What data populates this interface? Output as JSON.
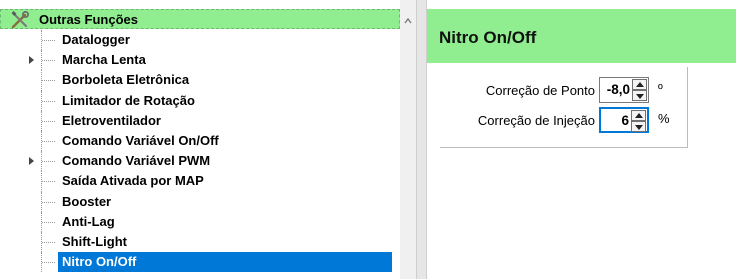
{
  "tree": {
    "header_label": "Outras Funções",
    "items": [
      {
        "label": "Datalogger",
        "expandable": false
      },
      {
        "label": "Marcha Lenta",
        "expandable": true
      },
      {
        "label": "Borboleta Eletrônica",
        "expandable": false
      },
      {
        "label": "Limitador de Rotação",
        "expandable": false
      },
      {
        "label": "Eletroventilador",
        "expandable": false
      },
      {
        "label": "Comando Variável On/Off",
        "expandable": false
      },
      {
        "label": "Comando Variável PWM",
        "expandable": true
      },
      {
        "label": "Saída Ativada por MAP",
        "expandable": false
      },
      {
        "label": "Booster",
        "expandable": false
      },
      {
        "label": "Anti-Lag",
        "expandable": false
      },
      {
        "label": "Shift-Light",
        "expandable": false
      },
      {
        "label": "Nitro On/Off",
        "expandable": false,
        "selected": true
      }
    ]
  },
  "detail": {
    "title": "Nitro On/Off",
    "fields": [
      {
        "label": "Correção de Ponto",
        "value": "-8,0",
        "unit": "º"
      },
      {
        "label": "Correção de Injeção",
        "value": "6",
        "unit": "%"
      }
    ]
  },
  "colors": {
    "header_green": "#90ee90",
    "selection_blue": "#0078d7",
    "focus_blue": "#0078d7"
  },
  "icons": {
    "tree_header": "tools-icon",
    "expander": "expand-arrow-icon",
    "scroll": "scroll-up-arrow-icon",
    "spin_up": "spin-up-arrow-icon",
    "spin_down": "spin-down-arrow-icon"
  }
}
